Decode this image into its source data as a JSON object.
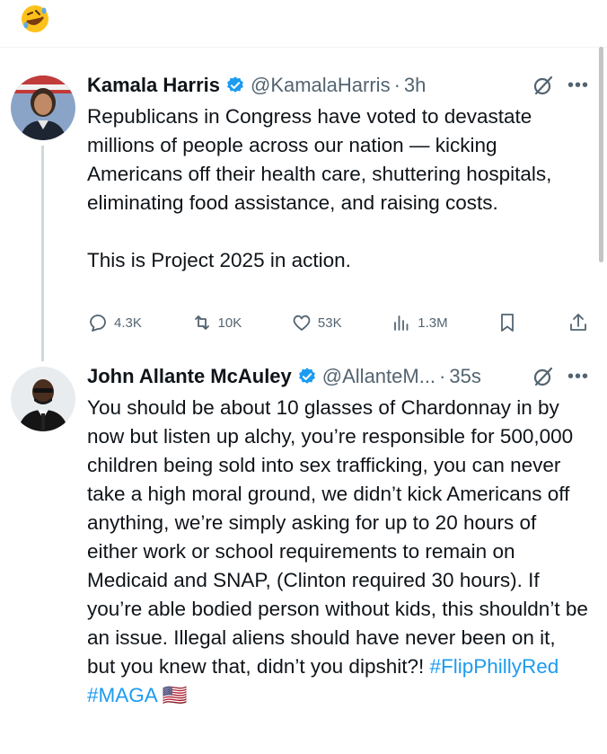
{
  "top_emoji": {
    "icon": "rolling-on-floor-laughing-emoji"
  },
  "tweets": [
    {
      "name": "Kamala Harris",
      "handle": "@KamalaHarris",
      "dot": "·",
      "time": "3h",
      "text": "Republicans in Congress have voted to devastate millions of people across our nation — kicking Americans off their health care, shuttering hospitals, eliminating food assistance, and raising costs.\n\nThis is Project 2025 in action.",
      "actions": {
        "replies": "4.3K",
        "reposts": "10K",
        "likes": "53K",
        "views": "1.3M"
      }
    },
    {
      "name": "John Allante McAuley",
      "handle": "@AllanteM...",
      "dot": "·",
      "time": "35s",
      "text": "You should be about 10 glasses of Chardonnay in by now but listen up alchy, you’re responsible for 500,000 children being sold into sex trafficking, you can never take a high moral ground, we didn’t kick Americans off anything, we’re simply asking for up to 20 hours of either work or school requirements to remain on Medicaid and SNAP, (Clinton required 30 hours). If you’re able bodied person without kids, this shouldn’t be an issue. Illegal aliens should have never been on it, but you knew that, didn’t you dipshit?! ",
      "hashtag1": "#FlipPhillyRed",
      "hashtag2": "#MAGA",
      "flag": "🇺🇸"
    }
  ],
  "colors": {
    "accent": "#1d9bf0",
    "secondary_text": "#536471",
    "verified": "#1d9bf0"
  }
}
